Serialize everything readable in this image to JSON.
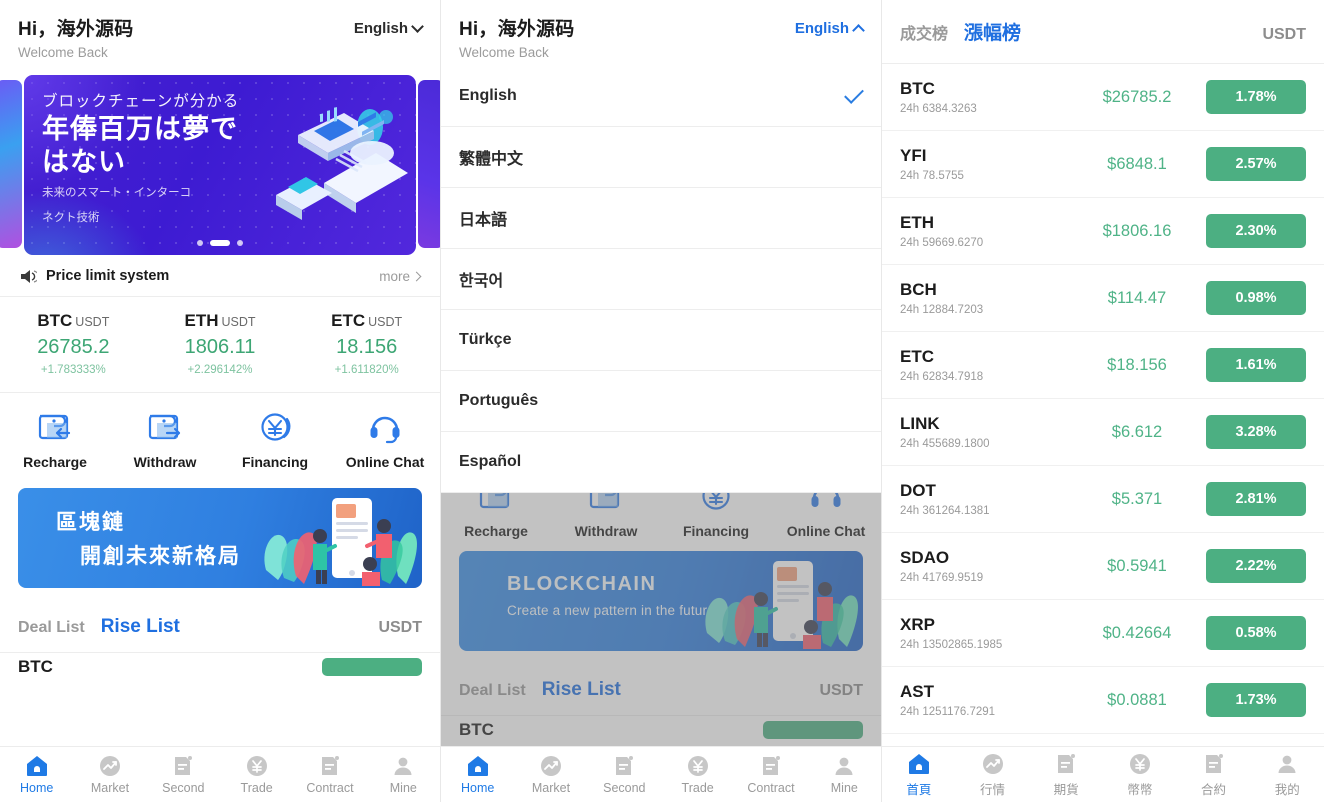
{
  "panel1": {
    "greeting": {
      "hi": "Hi，海外源码",
      "sub": "Welcome Back",
      "lang": "English"
    },
    "carousel": {
      "line1": "ブロックチェーンが分かる",
      "big1": "年俸百万は夢で",
      "big2": "はない",
      "small1": "未来のスマート・インターコ",
      "small2": "ネクト技術",
      "dot_index": 1,
      "dot_count": 3
    },
    "notice": {
      "text": "Price limit system",
      "more": "more",
      "icon": "speaker-icon"
    },
    "tickers": [
      {
        "symbol": "BTC",
        "unit": "USDT",
        "price": "26785.2",
        "change": "+1.783333%"
      },
      {
        "symbol": "ETH",
        "unit": "USDT",
        "price": "1806.11",
        "change": "+2.296142%"
      },
      {
        "symbol": "ETC",
        "unit": "USDT",
        "price": "18.156",
        "change": "+1.611820%"
      }
    ],
    "actions": [
      {
        "label": "Recharge",
        "icon": "wallet-in-icon"
      },
      {
        "label": "Withdraw",
        "icon": "wallet-out-icon"
      },
      {
        "label": "Financing",
        "icon": "yen-circle-icon"
      },
      {
        "label": "Online Chat",
        "icon": "headset-icon"
      }
    ],
    "banner": {
      "cn_line1": "區塊鏈",
      "cn_line2": "開創未來新格局"
    },
    "list_header": {
      "tab_deal": "Deal List",
      "tab_rise": "Rise List",
      "unit": "USDT"
    },
    "clipped_symbol": "BTC"
  },
  "panel2": {
    "greeting": {
      "hi": "Hi，海外源码",
      "sub": "Welcome Back",
      "lang": "English"
    },
    "languages": [
      {
        "name": "English",
        "selected": true
      },
      {
        "name": "繁體中文",
        "selected": false
      },
      {
        "name": "日本語",
        "selected": false
      },
      {
        "name": "한국어",
        "selected": false
      },
      {
        "name": "Türkçe",
        "selected": false
      },
      {
        "name": "Português",
        "selected": false
      },
      {
        "name": "Español",
        "selected": false
      }
    ],
    "actions": [
      {
        "label": "Recharge",
        "icon": "wallet-in-icon"
      },
      {
        "label": "Withdraw",
        "icon": "wallet-out-icon"
      },
      {
        "label": "Financing",
        "icon": "yen-circle-icon"
      },
      {
        "label": "Online Chat",
        "icon": "headset-icon"
      }
    ],
    "banner": {
      "en_line1": "BLOCKCHAIN",
      "en_line2": "Create a new pattern in the future"
    },
    "list_header": {
      "tab_deal": "Deal List",
      "tab_rise": "Rise List",
      "unit": "USDT"
    },
    "clipped_symbol": "BTC"
  },
  "panel3": {
    "list_header": {
      "tab_deal": "成交榜",
      "tab_rise": "漲幅榜",
      "unit": "USDT"
    },
    "coins": [
      {
        "symbol": "BTC",
        "volume": "24h 6384.3263",
        "price": "$26785.2",
        "change": "1.78%"
      },
      {
        "symbol": "YFI",
        "volume": "24h 78.5755",
        "price": "$6848.1",
        "change": "2.57%"
      },
      {
        "symbol": "ETH",
        "volume": "24h 59669.6270",
        "price": "$1806.16",
        "change": "2.30%"
      },
      {
        "symbol": "BCH",
        "volume": "24h 12884.7203",
        "price": "$114.47",
        "change": "0.98%"
      },
      {
        "symbol": "ETC",
        "volume": "24h 62834.7918",
        "price": "$18.156",
        "change": "1.61%"
      },
      {
        "symbol": "LINK",
        "volume": "24h 455689.1800",
        "price": "$6.612",
        "change": "3.28%"
      },
      {
        "symbol": "DOT",
        "volume": "24h 361264.1381",
        "price": "$5.371",
        "change": "2.81%"
      },
      {
        "symbol": "SDAO",
        "volume": "24h 41769.9519",
        "price": "$0.5941",
        "change": "2.22%"
      },
      {
        "symbol": "XRP",
        "volume": "24h 13502865.1985",
        "price": "$0.42664",
        "change": "0.58%"
      },
      {
        "symbol": "AST",
        "volume": "24h 1251176.7291",
        "price": "$0.0881",
        "change": "1.73%"
      }
    ]
  },
  "tabbar_en": [
    {
      "label": "Home",
      "icon": "home-icon",
      "active": true
    },
    {
      "label": "Market",
      "icon": "market-icon",
      "active": false
    },
    {
      "label": "Second",
      "icon": "second-icon",
      "active": false
    },
    {
      "label": "Trade",
      "icon": "trade-icon",
      "active": false
    },
    {
      "label": "Contract",
      "icon": "contract-icon",
      "active": false
    },
    {
      "label": "Mine",
      "icon": "mine-icon",
      "active": false
    }
  ],
  "tabbar_cn": [
    {
      "label": "首頁",
      "icon": "home-icon",
      "active": true
    },
    {
      "label": "行情",
      "icon": "market-icon",
      "active": false
    },
    {
      "label": "期貨",
      "icon": "second-icon",
      "active": false
    },
    {
      "label": "幣幣",
      "icon": "trade-icon",
      "active": false
    },
    {
      "label": "合約",
      "icon": "contract-icon",
      "active": false
    },
    {
      "label": "我的",
      "icon": "mine-icon",
      "active": false
    }
  ],
  "colors": {
    "accent_blue": "#1f6fe0",
    "tab_active": "#1f7ae5",
    "green_badge": "#4caf82",
    "green_text": "#4fb387",
    "ticker_green": "#3da674",
    "muted": "#9a9a9a"
  }
}
